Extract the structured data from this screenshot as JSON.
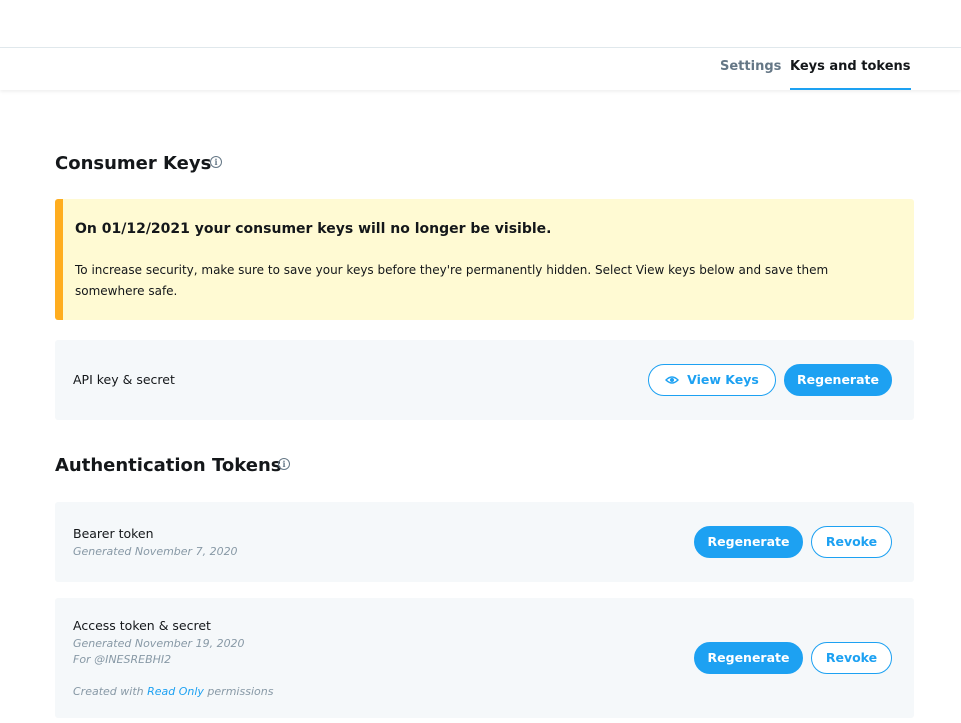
{
  "tabs": [
    {
      "label": "Settings",
      "active": false
    },
    {
      "label": "Keys and tokens",
      "active": true
    }
  ],
  "consumer_keys": {
    "title": "Consumer Keys",
    "info_icon": "info-icon",
    "warning": {
      "title": "On 01/12/2021 your consumer keys will no longer be visible.",
      "body": "To increase security, make sure to save your keys before they're permanently hidden. Select View keys below and save them somewhere safe."
    },
    "api_key": {
      "label": "API key & secret",
      "view_keys_label": "View Keys",
      "view_keys_icon": "eye-icon",
      "regenerate_label": "Regenerate"
    }
  },
  "auth_tokens": {
    "title": "Authentication Tokens",
    "info_icon": "info-icon",
    "bearer": {
      "label": "Bearer token",
      "generated": "Generated November 7, 2020",
      "regenerate_label": "Regenerate",
      "revoke_label": "Revoke"
    },
    "access": {
      "label": "Access token & secret",
      "generated": "Generated November 19, 2020",
      "for_user": "For @INESREBHI2",
      "created_prefix": "Created with ",
      "permission": "Read Only",
      "created_suffix": " permissions",
      "regenerate_label": "Regenerate",
      "revoke_label": "Revoke"
    }
  },
  "colors": {
    "accent": "#1da1f2",
    "warning_bg": "#fffad3",
    "warning_bar": "#ffad1f",
    "card_bg": "#f5f8fa"
  }
}
